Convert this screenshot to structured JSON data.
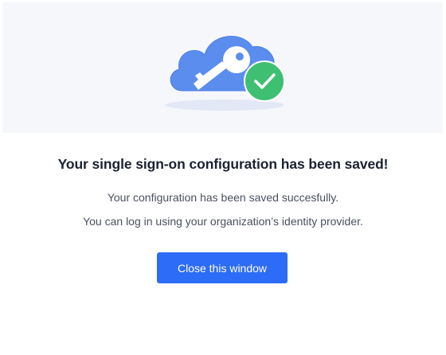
{
  "dialog": {
    "title": "Your single sign-on configuration has been saved!",
    "message_line1": "Your configuration has been saved succesfully.",
    "message_line2": "You can log in using your organization’s identity provider.",
    "close_button_label": "Close this window"
  },
  "illustration": {
    "icons": [
      "cloud-icon",
      "key-icon",
      "checkmark-icon"
    ]
  },
  "colors": {
    "accent": "#2d6cf6",
    "cloud": "#5b8def",
    "success": "#3fbf72",
    "hero_background": "#f6f7fb"
  }
}
